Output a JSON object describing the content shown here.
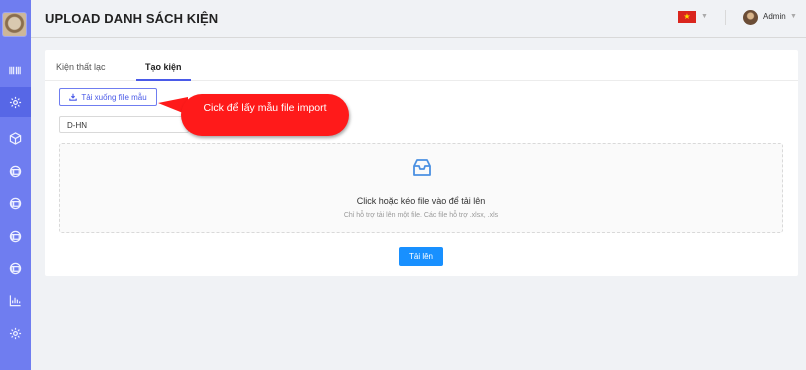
{
  "header": {
    "title": "UPLOAD DANH SÁCH KIỆN",
    "user_name": "Admin"
  },
  "tabs": [
    {
      "label": "Kiện thất lạc"
    },
    {
      "label": "Tạo kiện"
    }
  ],
  "form": {
    "download_label": "Tải xuống file mẫu",
    "select_value": "D-HN"
  },
  "dropzone": {
    "text": "Click hoặc kéo file vào để tải lên",
    "hint": "Chỉ hỗ trợ tải lên một file. Các file hỗ trợ .xlsx, .xls"
  },
  "upload_label": "Tải lên",
  "callout": {
    "text": "Cick để lấy mẫu file import"
  },
  "sidebar": {
    "icons": [
      "logo",
      "barcode-icon",
      "settings-icon",
      "box-icon",
      "package-icon",
      "package-icon",
      "package-icon",
      "package-icon",
      "chart-icon",
      "settings-icon"
    ]
  },
  "colors": {
    "sidebar": "#6f7df0",
    "accent": "#4a5ae8",
    "primary_button": "#1890ff",
    "callout": "#ff1a1a"
  }
}
